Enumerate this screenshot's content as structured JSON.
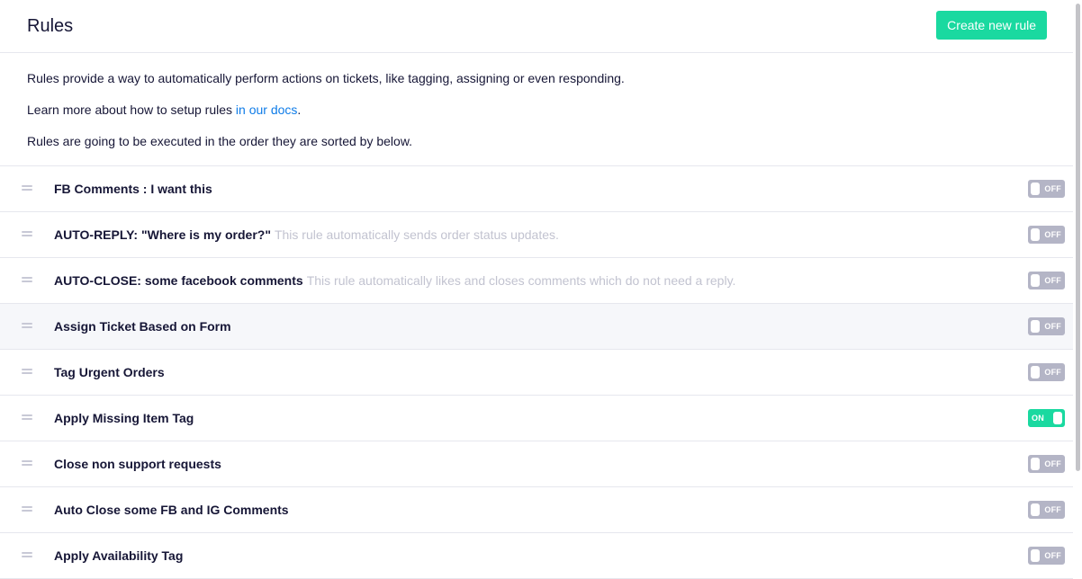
{
  "header": {
    "title": "Rules",
    "create_button_label": "Create new rule"
  },
  "intro": {
    "line1": "Rules provide a way to automatically perform actions on tickets, like tagging, assigning or even responding.",
    "line2_prefix": "Learn more about how to setup rules ",
    "line2_link": "in our docs",
    "line2_suffix": ".",
    "line3": "Rules are going to be executed in the order they are sorted by below."
  },
  "rules": [
    {
      "name": "FB Comments : I want this",
      "description": "",
      "toggle_label": "OFF",
      "enabled": false
    },
    {
      "name": "AUTO-REPLY: \"Where is my order?\"",
      "description": "This rule automatically sends order status updates.",
      "toggle_label": "OFF",
      "enabled": false
    },
    {
      "name": "AUTO-CLOSE: some facebook comments",
      "description": "This rule automatically likes and closes comments which do not need a reply.",
      "toggle_label": "OFF",
      "enabled": false
    },
    {
      "name": "Assign Ticket Based on Form",
      "description": "",
      "toggle_label": "OFF",
      "enabled": false
    },
    {
      "name": "Tag Urgent Orders",
      "description": "",
      "toggle_label": "OFF",
      "enabled": false
    },
    {
      "name": "Apply Missing Item Tag",
      "description": "",
      "toggle_label": "ON",
      "enabled": true
    },
    {
      "name": "Close non support requests",
      "description": "",
      "toggle_label": "OFF",
      "enabled": false
    },
    {
      "name": "Auto Close some FB and IG Comments",
      "description": "",
      "toggle_label": "OFF",
      "enabled": false
    },
    {
      "name": "Apply Availability Tag",
      "description": "",
      "toggle_label": "OFF",
      "enabled": false
    }
  ],
  "colors": {
    "accent": "#1ad9a0",
    "link": "#0f7ce8",
    "toggle_off": "#b4b5c6",
    "text_primary": "#161636",
    "text_muted": "#c2c3d0"
  },
  "icons": {
    "drag_handle": "drag-handle-icon"
  }
}
